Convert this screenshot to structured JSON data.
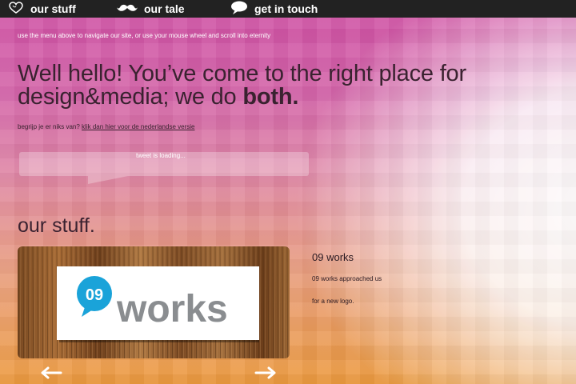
{
  "nav": {
    "items": [
      {
        "label": "our stuff",
        "icon": "heart-icon"
      },
      {
        "label": "our tale",
        "icon": "mustache-icon"
      },
      {
        "label": "get in touch",
        "icon": "speech-bubble-icon"
      }
    ]
  },
  "intro": "use the menu above to navigate our site, or use your mouse wheel and scroll into eternity",
  "headline": {
    "part1": "Well hello! You’ve come to the right place for design&media; we do ",
    "bold": "both."
  },
  "dutch": {
    "prefix": "begrijp je er niks van? ",
    "link": "klik dan hier voor de nederlandse versie"
  },
  "tweet": {
    "text": "tweet is loading..."
  },
  "section": {
    "title": "our stuff."
  },
  "project": {
    "logo_number": "09",
    "logo_word": "works",
    "title": "09 works",
    "desc_line1": "09 works approached us",
    "desc_line2": "for a new logo."
  },
  "controls": {
    "prev_icon": "arrow-left-icon",
    "next_icon": "arrow-right-icon"
  },
  "colors": {
    "nav_bg": "#222222",
    "logo_blue": "#1aa3d9",
    "logo_gray": "#8a8d90",
    "text_dark": "#3a2230"
  }
}
